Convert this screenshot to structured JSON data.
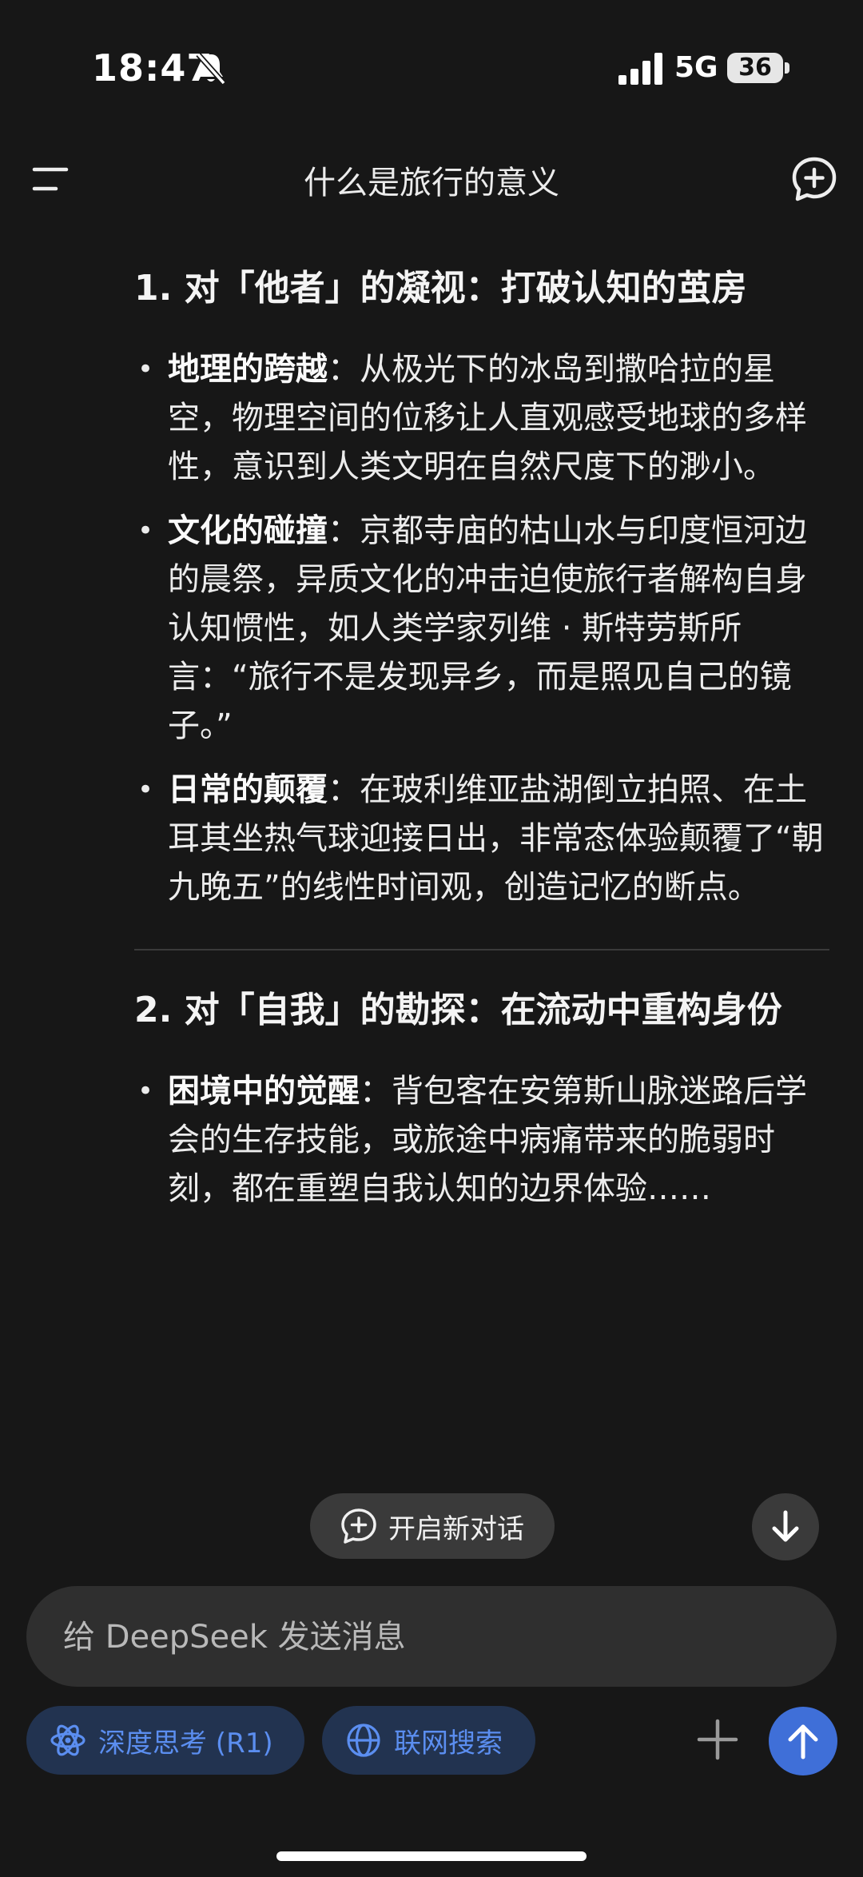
{
  "status_bar": {
    "time": "18:47",
    "network": "5G",
    "battery": "36"
  },
  "header": {
    "title": "什么是旅行的意义"
  },
  "sections": [
    {
      "heading": "1. 对「他者」的凝视：打破认知的茧房",
      "bullets": [
        {
          "bold": "地理的跨越",
          "text": "：从极光下的冰岛到撒哈拉的星空，物理空间的位移让人直观感受地球的多样性，意识到人类文明在自然尺度下的渺小。"
        },
        {
          "bold": "文化的碰撞",
          "text": "：京都寺庙的枯山水与印度恒河边的晨祭，异质文化的冲击迫使旅行者解构自身认知惯性，如人类学家列维 · 斯特劳斯所言：“旅行不是发现异乡，而是照见自己的镜子。”"
        },
        {
          "bold": "日常的颠覆",
          "text": "：在玻利维亚盐湖倒立拍照、在土耳其坐热气球迎接日出，非常态体验颠覆了“朝九晚五”的线性时间观，创造记忆的断点。"
        }
      ]
    },
    {
      "heading": "2. 对「自我」的勘探：在流动中重构身份",
      "bullets": [
        {
          "bold": "困境中的觉醒",
          "text": "：背包客在安第斯山脉迷路后学会的生存技能，或旅途中病痛带来的脆弱时刻，都在重塑自我认知的边界体验……"
        }
      ]
    }
  ],
  "floating": {
    "new_chat_label": "开启新对话"
  },
  "composer": {
    "placeholder": "给 DeepSeek 发送消息",
    "deep_think_label": "深度思考 (R1)",
    "web_search_label": "联网搜索"
  },
  "colors": {
    "background": "#171717",
    "accent": "#3f6fd8",
    "chip_bg": "#223350",
    "chip_text": "#5b8ef0"
  }
}
